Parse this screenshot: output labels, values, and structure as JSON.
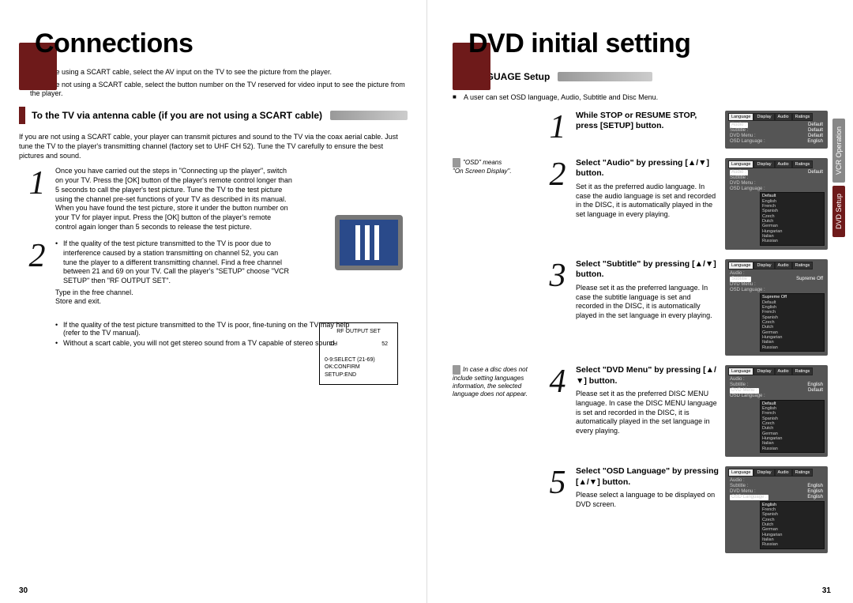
{
  "left": {
    "title": "Connections",
    "bullets": [
      "If you are using a SCART cable, select the AV input on the TV to see the picture from the player.",
      "If you are not using a SCART cable, select the button number on the TV reserved for video input to see the picture from the player."
    ],
    "section": "To the TV via antenna cable (if you are not using a SCART cable)",
    "intro": "If you are not using a SCART cable, your player can transmit pictures and sound to the TV via the coax aerial cable. Just tune the TV to the player's transmitting channel (factory set to UHF CH 52). Tune the TV carefully to ensure the best pictures and sound.",
    "step1": "Once you have carried out the steps in \"Connecting up the player\", switch on your TV.\nPress the [OK] button of the player's remote control longer than 5 seconds to call the player's test picture.\nTune the TV to the test picture using the channel pre-set functions of your TV as described in its manual.\nWhen you have found the test picture, store it under the button number on your TV for player input.\nPress the [OK] button of the player's remote control again longer than 5 seconds to release the test picture.",
    "step2_items": [
      "If the quality of the test picture transmitted to the TV is poor due to interference caused by a station transmitting on channel 52, you can tune the player to a different transmitting channel. Find a free channel between 21 and 69 on your TV. Call the player's \"SETUP\" choose \"VCR SETUP\" then \"RF OUTPUT SET\"."
    ],
    "step2_tail": [
      "Type in the free channel.",
      "Store and exit."
    ],
    "after_items": [
      "If the quality of the test picture transmitted to the TV is poor, fine-tuning on the TV may help (refer to the TV manual).",
      "Without a scart cable, you will not get stereo sound from a TV capable of stereo sound."
    ],
    "osd_box": {
      "title": "RF OUTPUT SET",
      "ch": "CH",
      "chv": "52",
      "hint1": "0-9:SELECT (21-69)",
      "hint2": "OK:CONFIRM    SETUP:END"
    },
    "pagenum": "30"
  },
  "right": {
    "title": "DVD initial setting",
    "section": "LANGUAGE Setup",
    "bullets": [
      "A user can set OSD language, Audio, Subtitle and Disc Menu."
    ],
    "osd_note_title": "\"OSD\" means",
    "osd_note_body": "\"On Screen Display\".",
    "disc_note": "In case a disc does not include setting languages information, the selected language does not appear.",
    "steps": [
      {
        "n": "1",
        "head": "While STOP or RESUME STOP, press [SETUP] button.",
        "body": "",
        "osd": {
          "tabs": [
            "Language",
            "Display",
            "Audio",
            "Ratings"
          ],
          "rows": [
            [
              "Audio :",
              "Default"
            ],
            [
              "Subtitle :",
              "Default"
            ],
            [
              "DVD Menu :",
              "Default"
            ],
            [
              "OSD Language :",
              "English"
            ]
          ],
          "highlight": "Audio :"
        }
      },
      {
        "n": "2",
        "head": "Select \"Audio\" by pressing [▲/▼] button.",
        "body": "Set it as the preferred audio language. In case the audio language is set and recorded in the DISC, it is automatically played in the set language in every playing.",
        "osd": {
          "tabs": [
            "Language",
            "Display",
            "Audio",
            "Ratings"
          ],
          "rows": [
            [
              "Audio :",
              "Default"
            ],
            [
              "Subtitle :",
              ""
            ],
            [
              "DVD Menu :",
              ""
            ],
            [
              "OSD Language :",
              ""
            ]
          ],
          "highlight": "Audio :",
          "drop": [
            "Default",
            "English",
            "French",
            "Spanish",
            "Czech",
            "Dutch",
            "German",
            "Hungarian",
            "Italian",
            "Russian"
          ]
        }
      },
      {
        "n": "3",
        "head": "Select \"Subtitle\" by pressing [▲/▼] button.",
        "body": "Please set it as the preferred language. In case the subtitle language is set and recorded in the DISC, it is automatically played in the set language in every playing.",
        "osd": {
          "tabs": [
            "Language",
            "Display",
            "Audio",
            "Ratings"
          ],
          "rows": [
            [
              "Audio :",
              ""
            ],
            [
              "Subtitle :",
              "Supreme Off"
            ],
            [
              "DVD Menu :",
              ""
            ],
            [
              "OSD Language :",
              ""
            ]
          ],
          "highlight": "Subtitle :",
          "drop": [
            "Supreme Off",
            "Default",
            "English",
            "French",
            "Spanish",
            "Czech",
            "Dutch",
            "German",
            "Hungarian",
            "Italian",
            "Russian"
          ]
        }
      },
      {
        "n": "4",
        "head": "Select \"DVD Menu\" by pressing [▲/▼] button.",
        "body": "Please set it as the preferred DISC MENU language. In case the DISC MENU language is set and recorded in the DISC, it is automatically played in the set language in every playing.",
        "osd": {
          "tabs": [
            "Language",
            "Display",
            "Audio",
            "Ratings"
          ],
          "rows": [
            [
              "Audio :",
              ""
            ],
            [
              "Subtitle :",
              "English"
            ],
            [
              "DVD Menu :",
              "Default"
            ],
            [
              "OSD Language :",
              ""
            ]
          ],
          "highlight": "DVD Menu :",
          "drop": [
            "Default",
            "English",
            "French",
            "Spanish",
            "Czech",
            "Dutch",
            "German",
            "Hungarian",
            "Italian",
            "Russian"
          ]
        }
      },
      {
        "n": "5",
        "head": "Select \"OSD Language\" by pressing [▲/▼] button.",
        "body": "Please select a language to be displayed on DVD screen.",
        "osd": {
          "tabs": [
            "Language",
            "Display",
            "Audio",
            "Ratings"
          ],
          "rows": [
            [
              "Audio :",
              ""
            ],
            [
              "Subtitle :",
              "English"
            ],
            [
              "DVD Menu :",
              "English"
            ],
            [
              "OSD Language :",
              "English"
            ]
          ],
          "highlight": "OSD Language :",
          "drop": [
            "English",
            "French",
            "Spanish",
            "Czech",
            "Dutch",
            "German",
            "Hungarian",
            "Italian",
            "Russian"
          ]
        }
      }
    ],
    "vtabs": [
      "VCR Operation",
      "DVD Setup"
    ],
    "pagenum": "31"
  }
}
